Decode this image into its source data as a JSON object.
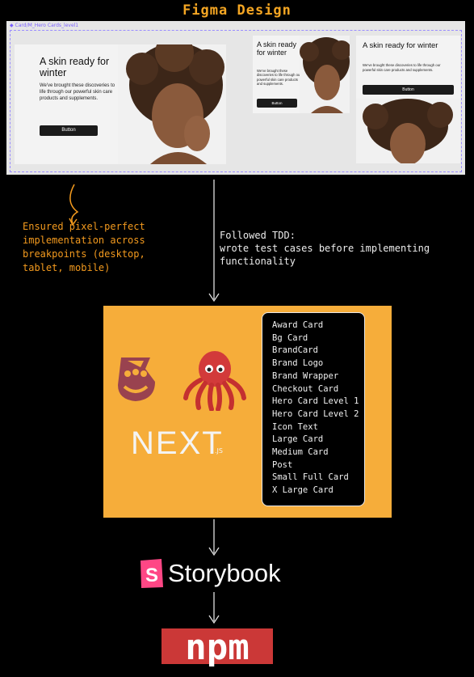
{
  "title": "Figma Design",
  "frame_label": "Card/M_Hero Cards_level1",
  "hero_cards": [
    {
      "heading": "A skin ready for winter",
      "body": "We've brought these discoveries to life through our powerful skin care products and supplements.",
      "button": "Button"
    },
    {
      "heading": "A skin ready for winter",
      "body": "We've brought these discoveries to life through our powerful skin care products and supplements.",
      "button": "Button"
    },
    {
      "heading": "A skin ready for winter",
      "body": "We've brought these discoveries to life through our powerful skin care products and supplements.",
      "button": "Button"
    }
  ],
  "annotation_left": [
    "Ensured pixel-perfect",
    "implementation across",
    "breakpoints (desktop,",
    "tablet, mobile)"
  ],
  "annotation_right": [
    "Followed TDD:",
    "wrote test cases before implementing",
    "functionality"
  ],
  "components": [
    "Award Card",
    "Bg Card",
    "BrandCard",
    "Brand Logo",
    "Brand Wrapper",
    "Checkout Card",
    "Hero Card Level 1",
    "Hero Card Level 2",
    "Icon Text",
    "Large Card",
    "Medium Card",
    "Post",
    "Small Full Card",
    "X Large Card"
  ],
  "tech_logos": [
    "jest-icon",
    "octopus-icon",
    "nextjs-logo"
  ],
  "nextjs_wordmark": "NEXT",
  "nextjs_suffix": ".JS",
  "storybook": {
    "icon_letter": "S",
    "label": "Storybook"
  },
  "npm": {
    "label": "npm"
  },
  "colors": {
    "accent_orange": "#f6ad3a",
    "figma_purple": "#7b61ff",
    "storybook_pink": "#ff4785",
    "npm_red": "#cb3837",
    "jest_red": "#99424f",
    "octopus_red": "#d23a3a"
  }
}
